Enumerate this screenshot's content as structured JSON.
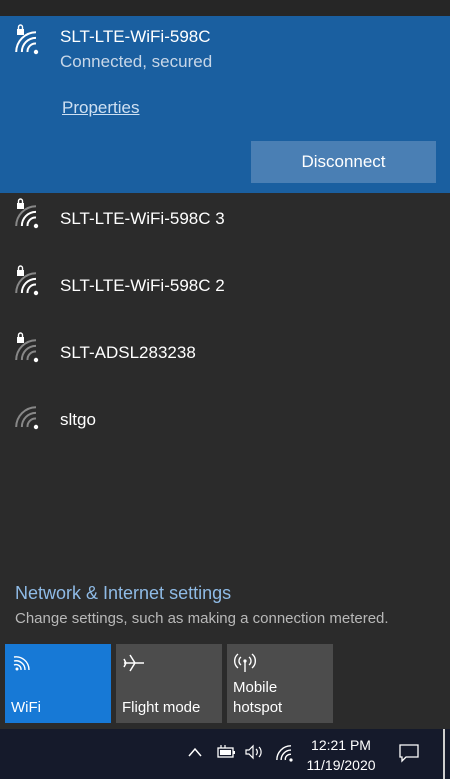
{
  "connected_network": {
    "name": "SLT-LTE-WiFi-598C",
    "status": "Connected, secured",
    "properties_label": "Properties",
    "disconnect_label": "Disconnect"
  },
  "networks": [
    {
      "name": "SLT-LTE-WiFi-598C 3",
      "secured": true
    },
    {
      "name": "SLT-LTE-WiFi-598C 2",
      "secured": true
    },
    {
      "name": "SLT-ADSL283238",
      "secured": true
    },
    {
      "name": "sltgo",
      "secured": false
    }
  ],
  "settings": {
    "link": "Network & Internet settings",
    "description": "Change settings, such as making a connection metered."
  },
  "quick_actions": [
    {
      "label": "WiFi",
      "active": true,
      "icon": "wifi-icon"
    },
    {
      "label": "Flight mode",
      "active": false,
      "icon": "airplane-icon"
    },
    {
      "label": "Mobile\nhotspot",
      "active": false,
      "icon": "hotspot-icon"
    }
  ],
  "taskbar": {
    "time": "12:21 PM",
    "date": "11/19/2020"
  },
  "colors": {
    "accent": "#1779d6",
    "connected_bg": "#1a5fa0",
    "panel_bg": "#2b2b2b",
    "link": "#8fbbe6"
  }
}
